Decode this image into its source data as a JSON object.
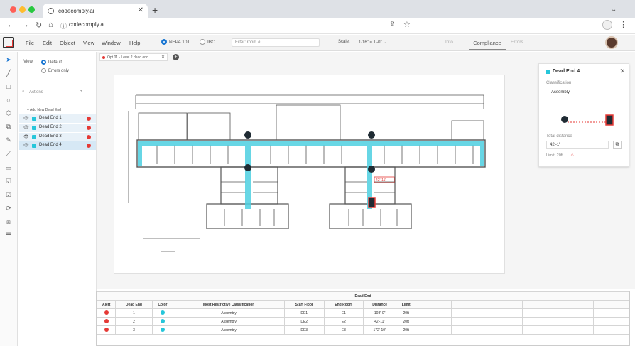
{
  "browser": {
    "tab_title": "codecomply.ai",
    "url": "codecomply.ai"
  },
  "app_menu": [
    "File",
    "Edit",
    "Object",
    "View",
    "Window",
    "Help"
  ],
  "code_options": [
    {
      "label": "NFPA 101",
      "selected": true
    },
    {
      "label": "IBC",
      "selected": false
    }
  ],
  "filter_placeholder": "Filter: room #",
  "scale": {
    "label": "Scale:",
    "value": "1/16\" = 1'-0\""
  },
  "right_tabs": {
    "left": "Info",
    "active": "Compliance",
    "right": "Errors"
  },
  "left_panel": {
    "view_label": "View:",
    "view_options": [
      "Default",
      "Errors only"
    ],
    "search_placeholder": "Actions",
    "add_button": "+ Add New Dead End",
    "layers": [
      "Dead End 1",
      "Dead End 2",
      "Dead End 3",
      "Dead End 4"
    ]
  },
  "document_tab": "Opt 01 - Level 2 dead end",
  "detail_panel": {
    "title": "Dead End 4",
    "classification_label": "Classification",
    "classification_value": "Assembly",
    "total_distance_label": "Total distance",
    "total_distance_value": "42'-1\"",
    "limit_label": "Limit: 20ft"
  },
  "table": {
    "title": "Dead End",
    "headers": [
      "Alert",
      "Dead End",
      "Color",
      "Most Restrictive Classification",
      "Start Floor",
      "End Room",
      "Distance",
      "Limit"
    ],
    "rows": [
      {
        "id": "1",
        "classification": "Assembly",
        "start": "DE1",
        "end": "E1",
        "distance": "108'-0\"",
        "limit": "20ft"
      },
      {
        "id": "2",
        "classification": "Assembly",
        "start": "DE2",
        "end": "E2",
        "distance": "42'-11\"",
        "limit": "20ft"
      },
      {
        "id": "3",
        "classification": "Assembly",
        "start": "DE3",
        "end": "E3",
        "distance": "172'-10\"",
        "limit": "20ft"
      }
    ]
  },
  "colors": {
    "accent": "#26c6da",
    "alert": "#e53935",
    "primary": "#1976d2",
    "marker_fill": "#1f2b33"
  },
  "plan_labels": {
    "dim_text": "42'-11\""
  }
}
